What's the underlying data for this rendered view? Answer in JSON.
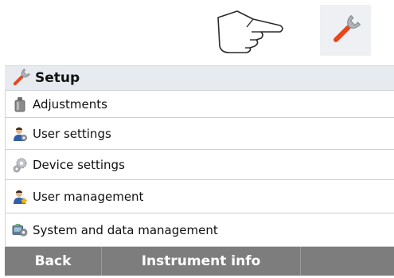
{
  "top": {
    "gesture_icon": "pointing-hand-icon",
    "shortcut_icon": "wrench-icon"
  },
  "header": {
    "icon": "wrench-icon",
    "title": "Setup"
  },
  "menu": {
    "items": [
      {
        "label": "Adjustments",
        "icon": "weight-icon"
      },
      {
        "label": "User settings",
        "icon": "user-settings-icon"
      },
      {
        "label": "Device settings",
        "icon": "gears-icon"
      },
      {
        "label": "User management",
        "icon": "user-management-icon"
      },
      {
        "label": "System and data management",
        "icon": "system-data-icon"
      }
    ]
  },
  "footer": {
    "back_label": "Back",
    "info_label": "Instrument info",
    "empty_label": ""
  },
  "colors": {
    "header_bg": "#e7ebf0",
    "footer_bg": "#7d7d7d",
    "wrench_accent": "#e8461e",
    "wrench_metal": "#b0b4b8"
  }
}
